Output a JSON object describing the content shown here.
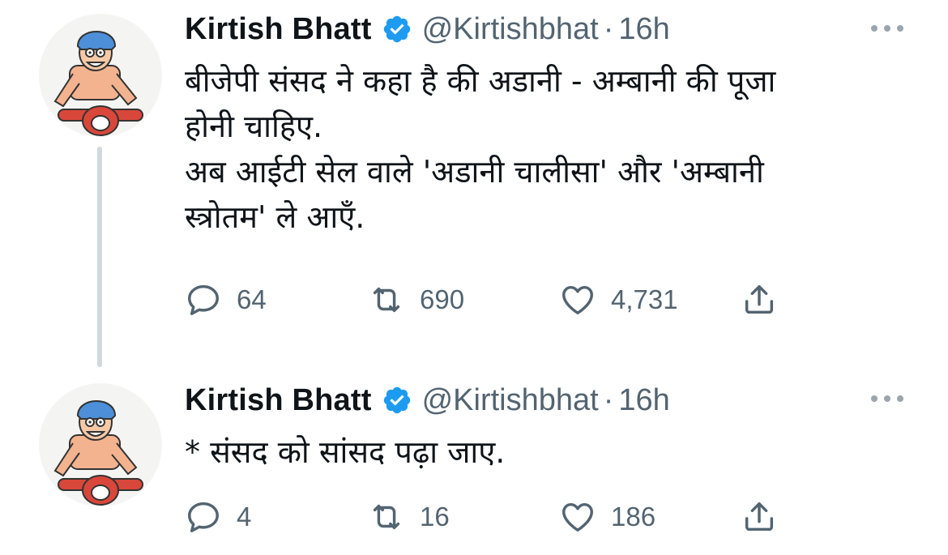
{
  "tweets": [
    {
      "author_name": "Kirtish Bhatt",
      "handle": "@Kirtishbhat",
      "separator": "·",
      "time": "16h",
      "lines": [
        "बीजेपी संसद ने कहा है की अडानी - अम्बानी की पूजा",
        "होनी चाहिए.",
        "अब आईटी सेल वाले 'अडानी चालीसा' और 'अम्बानी",
        "स्त्रोतम' ले आएँ."
      ],
      "replies": "64",
      "retweets": "690",
      "likes": "4,731"
    },
    {
      "author_name": "Kirtish Bhatt",
      "handle": "@Kirtishbhat",
      "separator": "·",
      "time": "16h",
      "lines": [
        "* संसद को सांसद पढ़ा जाए."
      ],
      "replies": "4",
      "retweets": "16",
      "likes": "186"
    }
  ],
  "icons": {
    "verified": "verified-badge-icon",
    "more": "more-options-icon",
    "reply": "reply-icon",
    "retweet": "retweet-icon",
    "like": "like-heart-icon",
    "share": "share-icon"
  },
  "colors": {
    "text": "#0f1419",
    "secondary": "#536471",
    "verified_blue": "#1d9bf0",
    "thread_line": "#cfd9de"
  }
}
